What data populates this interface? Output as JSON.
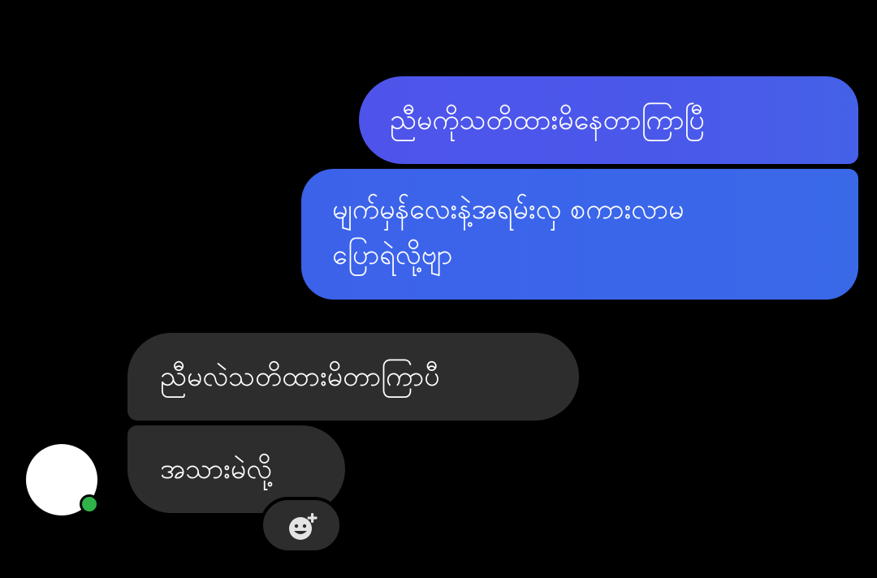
{
  "conversation": {
    "messages": [
      {
        "sender": "me",
        "text": "ညီမကိုသတိထားမိနေတာကြာပြီ"
      },
      {
        "sender": "me",
        "text": "မျက်မှန်လေးနဲ့အရမ်းလှ စကားလာမ\nပြောရဲလို့ဗျာ"
      },
      {
        "sender": "other",
        "text": "ညီမလဲသတိထားမိတာကြာပီ"
      },
      {
        "sender": "other",
        "text": "အသားမဲလို့"
      }
    ]
  },
  "contact": {
    "online": true
  },
  "icons": {
    "reaction": "add-reaction-icon"
  },
  "colors": {
    "background": "#000000",
    "sent_bubble_top": "#4a58ea",
    "sent_bubble_bottom": "#3a66ea",
    "received_bubble": "#2d2d2d",
    "online_indicator": "#2fb34a",
    "text": "#ffffff"
  }
}
